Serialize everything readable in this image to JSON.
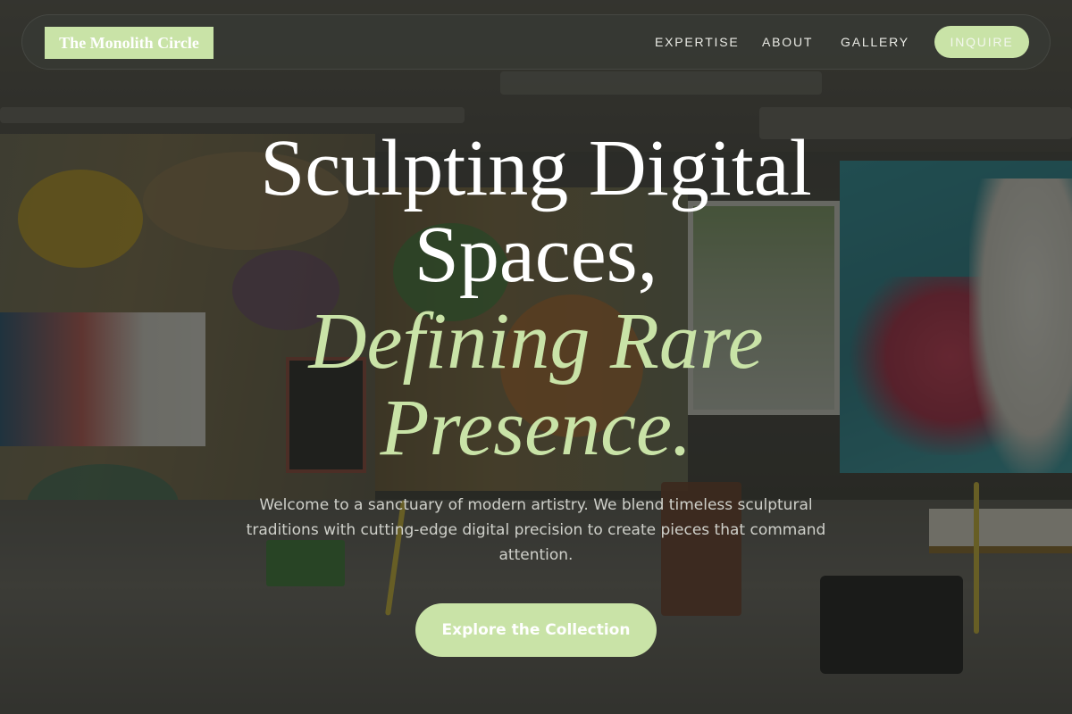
{
  "brand": {
    "name": "The Monolith Circle",
    "accent_color": "#c9e3a7"
  },
  "nav": {
    "links": [
      "EXPERTISE",
      "ABOUT",
      "GALLERY"
    ],
    "cta_label": "INQUIRE"
  },
  "hero": {
    "headline_lines": [
      "Sculpting Digital",
      "Spaces,"
    ],
    "headline_accent_lines": [
      "Defining Rare",
      "Presence."
    ],
    "lede": "Welcome to a sanctuary of modern artistry. We blend timeless sculptural traditions with cutting-edge digital precision to create pieces that command attention.",
    "cta_label": "Explore the Collection"
  }
}
